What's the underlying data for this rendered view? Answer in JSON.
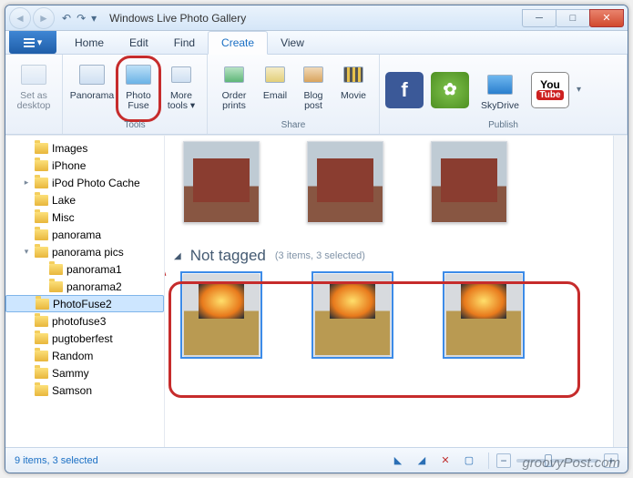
{
  "window": {
    "title": "Windows Live Photo Gallery"
  },
  "tabs": {
    "home": "Home",
    "edit": "Edit",
    "find": "Find",
    "create": "Create",
    "view": "View"
  },
  "ribbon": {
    "tools_group": "Tools",
    "share_group": "Share",
    "publish_group": "Publish",
    "set_as_desktop": "Set as desktop",
    "panorama": "Panorama",
    "photo_fuse": "Photo Fuse",
    "more_tools": "More tools ▾",
    "order_prints": "Order prints",
    "email": "Email",
    "blog_post": "Blog post",
    "movie": "Movie",
    "skydrive": "SkyDrive",
    "you": "You",
    "tube": "Tube"
  },
  "tree": [
    {
      "label": "Images",
      "indent": 1,
      "exp": ""
    },
    {
      "label": "iPhone",
      "indent": 1,
      "exp": ""
    },
    {
      "label": "iPod Photo Cache",
      "indent": 1,
      "exp": "▸"
    },
    {
      "label": "Lake",
      "indent": 1,
      "exp": ""
    },
    {
      "label": "Misc",
      "indent": 1,
      "exp": ""
    },
    {
      "label": "panorama",
      "indent": 1,
      "exp": ""
    },
    {
      "label": "panorama pics",
      "indent": 1,
      "exp": "▾"
    },
    {
      "label": "panorama1",
      "indent": 2,
      "exp": ""
    },
    {
      "label": "panorama2",
      "indent": 2,
      "exp": ""
    },
    {
      "label": "PhotoFuse2",
      "indent": 1,
      "exp": "",
      "sel": true
    },
    {
      "label": "photofuse3",
      "indent": 1,
      "exp": ""
    },
    {
      "label": "pugtoberfest",
      "indent": 1,
      "exp": ""
    },
    {
      "label": "Random",
      "indent": 1,
      "exp": ""
    },
    {
      "label": "Sammy",
      "indent": 1,
      "exp": ""
    },
    {
      "label": "Samson",
      "indent": 1,
      "exp": ""
    }
  ],
  "gallery": {
    "group_title": "Not tagged",
    "group_meta": "(3 items, 3 selected)"
  },
  "status": {
    "text": "9 items, 3 selected"
  },
  "watermark": "groovyPost.com"
}
